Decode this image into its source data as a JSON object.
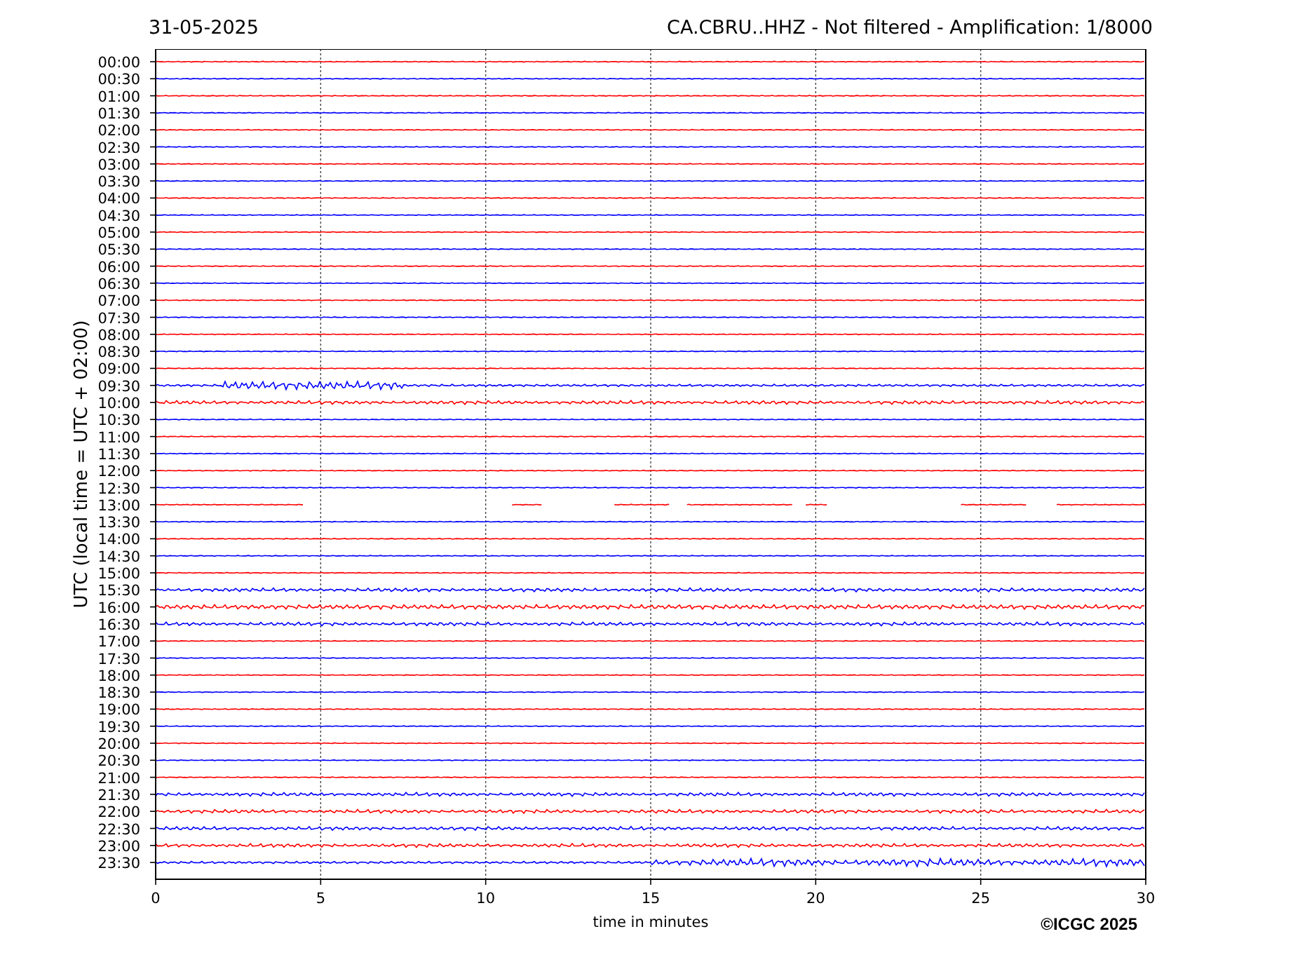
{
  "header": {
    "date": "31-05-2025",
    "title": "CA.CBRU..HHZ - Not filtered - Amplification: 1/8000"
  },
  "plot": {
    "ylabel": "UTC (local time = UTC + 02:00)",
    "xlabel": "time in minutes",
    "x_ticks": [
      "0",
      "5",
      "10",
      "15",
      "20",
      "25",
      "30"
    ],
    "rows": [
      {
        "label": "00:00",
        "color": "#ff0000",
        "kind": "quiet"
      },
      {
        "label": "00:30",
        "color": "#0000ff",
        "kind": "quiet"
      },
      {
        "label": "01:00",
        "color": "#ff0000",
        "kind": "quiet"
      },
      {
        "label": "01:30",
        "color": "#0000ff",
        "kind": "quiet"
      },
      {
        "label": "02:00",
        "color": "#ff0000",
        "kind": "quiet"
      },
      {
        "label": "02:30",
        "color": "#0000ff",
        "kind": "quiet"
      },
      {
        "label": "03:00",
        "color": "#ff0000",
        "kind": "quiet"
      },
      {
        "label": "03:30",
        "color": "#0000ff",
        "kind": "quiet"
      },
      {
        "label": "04:00",
        "color": "#ff0000",
        "kind": "quiet"
      },
      {
        "label": "04:30",
        "color": "#0000ff",
        "kind": "quiet"
      },
      {
        "label": "05:00",
        "color": "#ff0000",
        "kind": "quiet"
      },
      {
        "label": "05:30",
        "color": "#0000ff",
        "kind": "quiet"
      },
      {
        "label": "06:00",
        "color": "#ff0000",
        "kind": "quiet"
      },
      {
        "label": "06:30",
        "color": "#0000ff",
        "kind": "quiet"
      },
      {
        "label": "07:00",
        "color": "#ff0000",
        "kind": "quiet"
      },
      {
        "label": "07:30",
        "color": "#0000ff",
        "kind": "quiet"
      },
      {
        "label": "08:00",
        "color": "#ff0000",
        "kind": "quiet"
      },
      {
        "label": "08:30",
        "color": "#0000ff",
        "kind": "quiet"
      },
      {
        "label": "09:00",
        "color": "#ff0000",
        "kind": "quiet"
      },
      {
        "label": "09:30",
        "color": "#0000ff",
        "kind": "wavy"
      },
      {
        "label": "10:00",
        "color": "#ff0000",
        "kind": "noisy"
      },
      {
        "label": "10:30",
        "color": "#0000ff",
        "kind": "quiet"
      },
      {
        "label": "11:00",
        "color": "#ff0000",
        "kind": "quiet"
      },
      {
        "label": "11:30",
        "color": "#0000ff",
        "kind": "quiet"
      },
      {
        "label": "12:00",
        "color": "#ff0000",
        "kind": "quiet"
      },
      {
        "label": "12:30",
        "color": "#0000ff",
        "kind": "quiet"
      },
      {
        "label": "13:00",
        "color": "#ff0000",
        "kind": "gapped"
      },
      {
        "label": "13:30",
        "color": "#0000ff",
        "kind": "quiet"
      },
      {
        "label": "14:00",
        "color": "#ff0000",
        "kind": "quiet"
      },
      {
        "label": "14:30",
        "color": "#0000ff",
        "kind": "quiet"
      },
      {
        "label": "15:00",
        "color": "#ff0000",
        "kind": "quiet"
      },
      {
        "label": "15:30",
        "color": "#0000ff",
        "kind": "noisy"
      },
      {
        "label": "16:00",
        "color": "#ff0000",
        "kind": "wavy"
      },
      {
        "label": "16:30",
        "color": "#0000ff",
        "kind": "noisy"
      },
      {
        "label": "17:00",
        "color": "#ff0000",
        "kind": "quiet"
      },
      {
        "label": "17:30",
        "color": "#0000ff",
        "kind": "quiet"
      },
      {
        "label": "18:00",
        "color": "#ff0000",
        "kind": "quiet"
      },
      {
        "label": "18:30",
        "color": "#0000ff",
        "kind": "quiet"
      },
      {
        "label": "19:00",
        "color": "#ff0000",
        "kind": "quiet"
      },
      {
        "label": "19:30",
        "color": "#0000ff",
        "kind": "quiet"
      },
      {
        "label": "20:00",
        "color": "#ff0000",
        "kind": "quiet"
      },
      {
        "label": "20:30",
        "color": "#0000ff",
        "kind": "quiet"
      },
      {
        "label": "21:00",
        "color": "#ff0000",
        "kind": "quiet"
      },
      {
        "label": "21:30",
        "color": "#0000ff",
        "kind": "noisy"
      },
      {
        "label": "22:00",
        "color": "#ff0000",
        "kind": "noisy"
      },
      {
        "label": "22:30",
        "color": "#0000ff",
        "kind": "noisy"
      },
      {
        "label": "23:00",
        "color": "#ff0000",
        "kind": "noisy"
      },
      {
        "label": "23:30",
        "color": "#0000ff",
        "kind": "wavy"
      }
    ]
  },
  "copyright": "©ICGC 2025"
}
